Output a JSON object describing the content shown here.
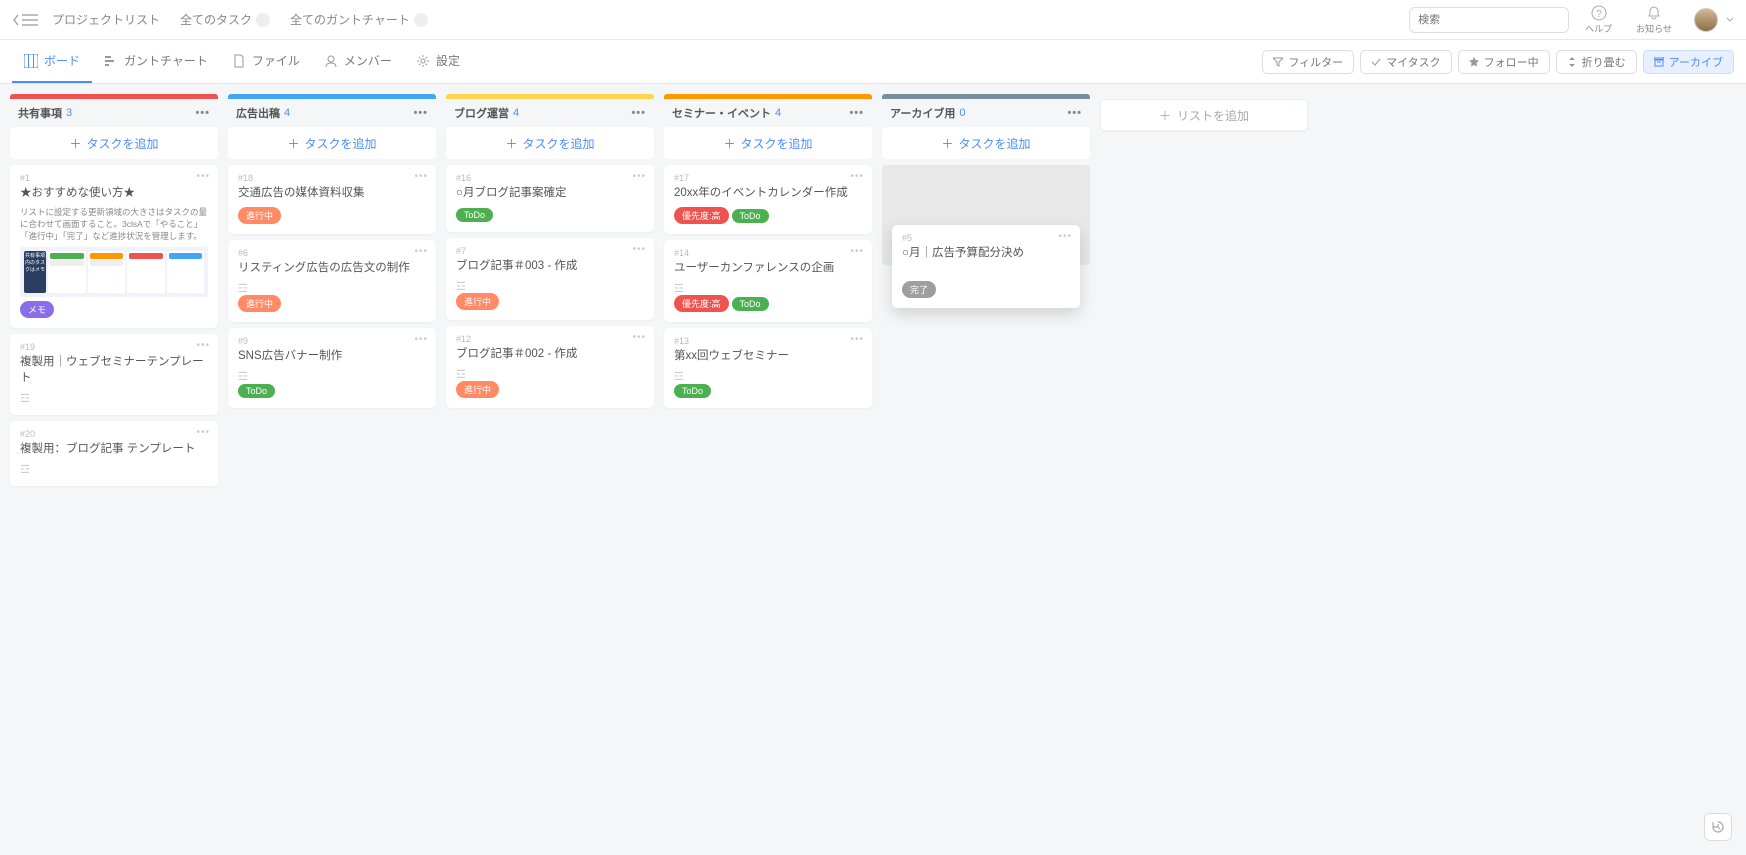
{
  "topnav": {
    "project_list": "プロジェクトリスト",
    "all_tasks": "全てのタスク",
    "all_gantt": "全てのガントチャート",
    "search_placeholder": "検索",
    "help": "ヘルプ",
    "notice": "お知らせ"
  },
  "tabs": {
    "board": "ボード",
    "gantt": "ガントチャート",
    "file": "ファイル",
    "member": "メンバー",
    "settings": "設定"
  },
  "actions": {
    "filter": "フィルター",
    "mytask": "マイタスク",
    "follow": "フォロー中",
    "fold": "折り畳む",
    "archive": "アーカイブ"
  },
  "add_task_label": "タスクを追加",
  "add_list_label": "リストを追加",
  "tags": {
    "memo": "メモ",
    "progress": "進行中",
    "todo": "ToDo",
    "prio": "優先度:高",
    "done": "完了"
  },
  "columns": [
    {
      "title": "共有事項",
      "count": "3",
      "color": "#ef5350"
    },
    {
      "title": "広告出稿",
      "count": "4",
      "color": "#42a5f5"
    },
    {
      "title": "ブログ運営",
      "count": "4",
      "color": "#ffd54f"
    },
    {
      "title": "セミナー・イベント",
      "count": "4",
      "color": "#ff9800"
    },
    {
      "title": "アーカイブ用",
      "count": "0",
      "color": "#78909c"
    }
  ],
  "cards": {
    "c1": {
      "num": "#1",
      "title": "★おすすめな使い方★",
      "text": "リストに設定する更新領域の大きさはタスクの量に合わせて画面すること。3clsAで「やること」「進行中」「完了」など進捗状況を管理します。"
    },
    "c19": {
      "num": "#19",
      "title": "複製用｜ウェブセミナーテンプレート"
    },
    "c20": {
      "num": "#20",
      "title": "複製用：ブログ記事 テンプレート"
    },
    "c18": {
      "num": "#18",
      "title": "交通広告の媒体資料収集"
    },
    "c6": {
      "num": "#6",
      "title": "リスティング広告の広告文の制作"
    },
    "c9": {
      "num": "#9",
      "title": "SNS広告バナー制作"
    },
    "c16": {
      "num": "#16",
      "title": "○月ブログ記事案確定"
    },
    "c7": {
      "num": "#7",
      "title": "ブログ記事＃003 - 作成"
    },
    "c12": {
      "num": "#12",
      "title": "ブログ記事＃002 - 作成"
    },
    "c17": {
      "num": "#17",
      "title": "20xx年のイベントカレンダー作成"
    },
    "c14": {
      "num": "#14",
      "title": "ユーザーカンファレンスの企画"
    },
    "c13": {
      "num": "#13",
      "title": "第xx回ウェブセミナー"
    },
    "c5": {
      "num": "#5",
      "title": "○月｜広告予算配分決め"
    }
  }
}
